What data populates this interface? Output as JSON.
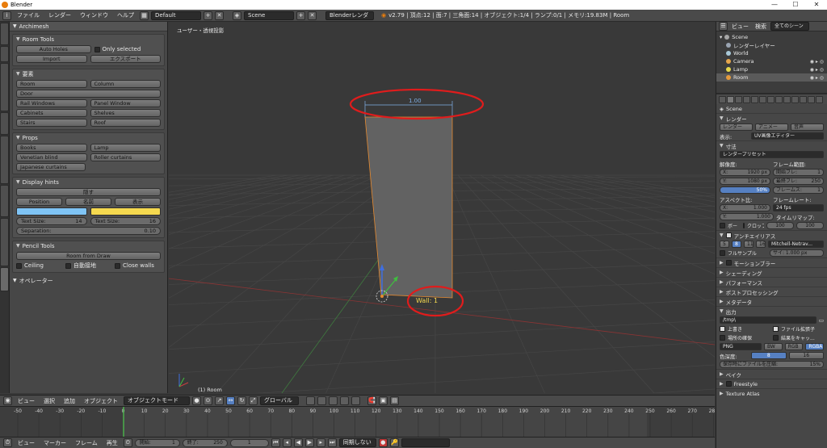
{
  "window": {
    "title": "Blender",
    "minimize": "—",
    "maximize": "☐",
    "close": "✕"
  },
  "info_header": {
    "menus": [
      "ファイル",
      "レンダー",
      "ウィンドウ",
      "ヘルプ"
    ],
    "screen": "Default",
    "scene": "Scene",
    "engine": "Blenderレンダー",
    "stats": "v2.79 | 頂点:12 | 面:7 | 三角面:14 | オブジェクト:1/4 | ランプ:0/1 | メモリ:19.83M | Room"
  },
  "tool_shelf": {
    "header": "Archimesh",
    "room_tools": {
      "title": "Room Tools",
      "auto_holes": "Auto Holes",
      "only_selected": "Only selected",
      "import": "Import",
      "export": "エクスポート"
    },
    "elements": {
      "title": "要素",
      "items": [
        "Room",
        "Column",
        "Door",
        "Rail Windows",
        "Panel Window",
        "Cabinets",
        "Shelves",
        "Stairs",
        "Roof"
      ]
    },
    "props": {
      "title": "Props",
      "items": [
        "Books",
        "Lamp",
        "Venetian blind",
        "Roller curtains",
        "Japanese curtains"
      ]
    },
    "display_hints": {
      "title": "Display hints",
      "hide": "隠す",
      "toggle_labels": [
        "Position",
        "名前",
        "表示"
      ],
      "text_size_1_label": "Text Size:",
      "text_size_1_value": "14",
      "text_size_2_label": "Text Size:",
      "text_size_2_value": "16",
      "separation_label": "Separation:",
      "separation_value": "0.10",
      "color_1": "#7fc4f5",
      "color_2": "#f5d94f"
    },
    "pencil_tools": {
      "title": "Pencil Tools",
      "room_from_draw": "Room from Draw",
      "ceiling": "Ceiling",
      "auto_join": "自動接地",
      "close_walls": "Close walls"
    },
    "operator": "オペレーター"
  },
  "viewport": {
    "label": "ユーザー・透視投影",
    "object_label": "(1) Room",
    "dimension": "1.00",
    "wall_label": "Wall: 1"
  },
  "viewport_header": {
    "menus": [
      "ビュー",
      "選択",
      "追加",
      "オブジェクト"
    ],
    "mode": "オブジェクトモード",
    "orientation": "グローバル"
  },
  "timeline": {
    "ticks": [
      "-50",
      "-40",
      "-30",
      "-20",
      "-10",
      "0",
      "10",
      "20",
      "30",
      "40",
      "50",
      "60",
      "70",
      "80",
      "90",
      "100",
      "110",
      "120",
      "130",
      "140",
      "150",
      "160",
      "170",
      "180",
      "190",
      "200",
      "210",
      "220",
      "230",
      "240",
      "250",
      "260",
      "270",
      "280"
    ],
    "menus": [
      "ビュー",
      "マーカー",
      "フレーム",
      "再生"
    ],
    "start_label": "開始:",
    "start_value": "1",
    "end_label": "終了:",
    "end_value": "250",
    "current": "1",
    "sync": "同期しない"
  },
  "outliner": {
    "header": {
      "view": "ビュー",
      "search": "検索",
      "scope": "全てのシーン"
    },
    "items": [
      {
        "name": "Scene",
        "color": "#a6a6a6"
      },
      {
        "name": "レンダーレイヤー",
        "color": "#9aa4b2"
      },
      {
        "name": "World",
        "color": "#a9c8d8"
      },
      {
        "name": "Camera",
        "color": "#e6a64c"
      },
      {
        "name": "Lamp",
        "color": "#e6d84c"
      },
      {
        "name": "Room",
        "color": "#e69a3c"
      }
    ]
  },
  "properties": {
    "scene_path": "Scene",
    "render": {
      "title": "レンダー",
      "buttons": [
        "レンダー",
        "アニメー",
        "音声"
      ],
      "display_label": "表示:",
      "display_value": "UV画像エディター"
    },
    "dimensions": {
      "title": "寸法",
      "preset": "レンダープリセット",
      "resolution_label": "解像度:",
      "frame_range_label": "フレーム範囲:",
      "res_x": "1920 px",
      "res_y": "1080 px",
      "res_pct": "50%",
      "frame_start_label": "開始フレ:",
      "frame_start": "1",
      "frame_end_label": "最終フレ:",
      "frame_end": "250",
      "frame_step_label": "フレームス:",
      "frame_step": "1",
      "aspect_label": "アスペクト比:",
      "frame_rate_label": "フレームレート:",
      "aspect_x": "1.000",
      "aspect_y": "1.000",
      "fps": "24 fps",
      "time_remap_label": "タイムリマップ:",
      "border": "ボー",
      "crop": "クロップ",
      "remap_old": "100",
      "remap_new": "100"
    },
    "antialiasing": {
      "title": "アンチエイリアス",
      "samples": [
        "5",
        "8",
        "11",
        "16"
      ],
      "filter": "Mitchell-Netrav...",
      "full_sample": "フルサンプル",
      "size": "サイ: 1.000 px"
    },
    "sections": [
      "モーションブラー",
      "シェーディング",
      "パフォーマンス",
      "ポストプロセッシング",
      "メタデータ"
    ],
    "output": {
      "title": "出力",
      "path": "/tmp\\",
      "overwrite": "上書き",
      "file_ext": "ファイル拡張子",
      "placeholders": "場所の確保",
      "cache": "結果をキャッ...",
      "format": "PNG",
      "bw": "BW",
      "rgb": "RGB",
      "rgba": "RGBA",
      "color_depth_label": "色深度:",
      "depth_8": "8",
      "depth_16": "16",
      "compression_label": "保存時にファイルを圧縮:",
      "compression_value": "15%"
    },
    "bake": "ベイク",
    "freestyle": "Freestyle",
    "texture_atlas": "Texture Atlas"
  }
}
